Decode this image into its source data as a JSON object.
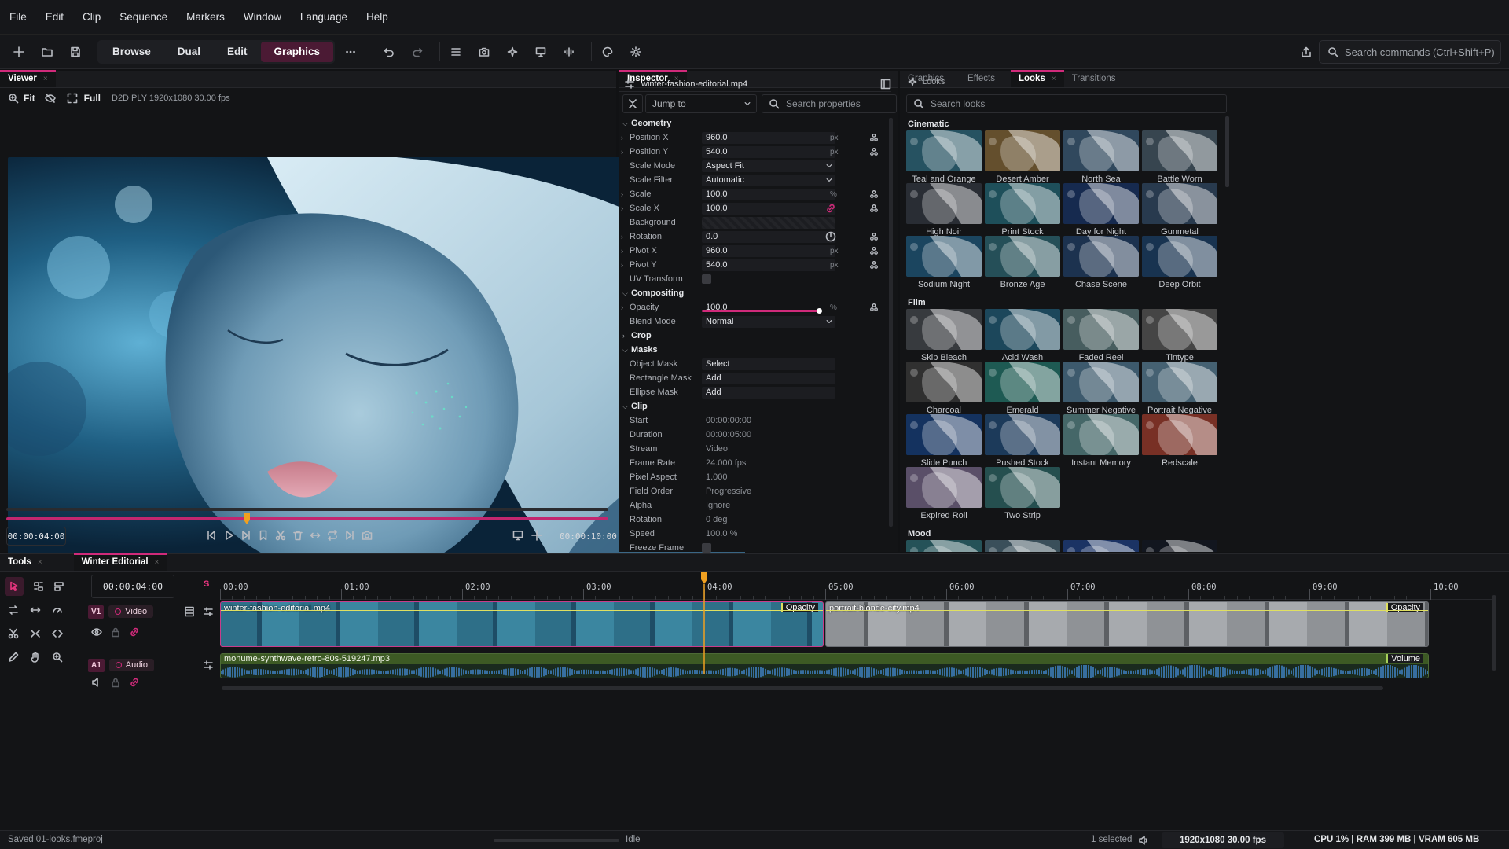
{
  "menu": [
    "File",
    "Edit",
    "Clip",
    "Sequence",
    "Markers",
    "Window",
    "Language",
    "Help"
  ],
  "modes": [
    "Browse",
    "Dual",
    "Edit",
    "Graphics"
  ],
  "active_mode": "Graphics",
  "command_search": {
    "placeholder": "Search commands (Ctrl+Shift+P)"
  },
  "viewer": {
    "tab": "Viewer",
    "fit": "Fit",
    "full": "Full",
    "info": "D2D PLY  1920x1080  30.00 fps",
    "current_time": "00:00:04:00",
    "duration": "00:00:10:00",
    "playhead_fraction": 0.4
  },
  "inspector": {
    "tab": "Inspector",
    "file": "winter-fashion-editorial.mp4",
    "jump_to": "Jump to",
    "search_placeholder": "Search properties",
    "sections": {
      "geometry": "Geometry",
      "compositing": "Compositing",
      "crop": "Crop",
      "masks": "Masks",
      "clip": "Clip"
    },
    "props": {
      "position_x": {
        "label": "Position X",
        "value": "960.0",
        "unit": "px"
      },
      "position_y": {
        "label": "Position Y",
        "value": "540.0",
        "unit": "px"
      },
      "scale_mode": {
        "label": "Scale Mode",
        "value": "Aspect Fit"
      },
      "scale_filter": {
        "label": "Scale Filter",
        "value": "Automatic"
      },
      "scale": {
        "label": "Scale",
        "value": "100.0",
        "unit": "%"
      },
      "scale_x": {
        "label": "Scale X",
        "value": "100.0"
      },
      "background": {
        "label": "Background"
      },
      "rotation": {
        "label": "Rotation",
        "value": "0.0"
      },
      "pivot_x": {
        "label": "Pivot X",
        "value": "960.0",
        "unit": "px"
      },
      "pivot_y": {
        "label": "Pivot Y",
        "value": "540.0",
        "unit": "px"
      },
      "uv_transform": {
        "label": "UV Transform"
      },
      "opacity": {
        "label": "Opacity",
        "value": "100.0",
        "unit": "%",
        "level": 1.0
      },
      "blend_mode": {
        "label": "Blend Mode",
        "value": "Normal"
      },
      "object_mask": {
        "label": "Object Mask",
        "value": "Select"
      },
      "rectangle_mask": {
        "label": "Rectangle Mask",
        "value": "Add"
      },
      "ellipse_mask": {
        "label": "Ellipse Mask",
        "value": "Add"
      }
    },
    "clip_info": [
      {
        "label": "Start",
        "value": "00:00:00:00"
      },
      {
        "label": "Duration",
        "value": "00:00:05:00"
      },
      {
        "label": "Stream",
        "value": "Video"
      },
      {
        "label": "Frame Rate",
        "value": "24.000 fps"
      },
      {
        "label": "Pixel Aspect",
        "value": "1.000"
      },
      {
        "label": "Field Order",
        "value": "Progressive"
      },
      {
        "label": "Alpha",
        "value": "Ignore"
      },
      {
        "label": "Rotation",
        "value": "0 deg"
      },
      {
        "label": "Speed",
        "value": "100.0 %"
      },
      {
        "label": "Freeze Frame",
        "value": ""
      }
    ]
  },
  "library": {
    "tabs": [
      "Graphics",
      "Effects",
      "Looks",
      "Transitions"
    ],
    "active_tab": "Looks",
    "crumb": "Looks",
    "search_placeholder": "Search looks",
    "groups": [
      {
        "name": "Cinematic",
        "looks": [
          {
            "name": "Teal and Orange",
            "tint": "#3b7f95"
          },
          {
            "name": "Desert Amber",
            "tint": "#9a7a45"
          },
          {
            "name": "North Sea",
            "tint": "#4a6f8f"
          },
          {
            "name": "Battle Worn",
            "tint": "#556a7a"
          },
          {
            "name": "High Noir",
            "tint": "#3f4650"
          },
          {
            "name": "Print Stock",
            "tint": "#2f7a8a"
          },
          {
            "name": "Day for Night",
            "tint": "#23417a"
          },
          {
            "name": "Gunmetal",
            "tint": "#3e5a78"
          },
          {
            "name": "Sodium Night",
            "tint": "#2a6a92"
          },
          {
            "name": "Bronze Age",
            "tint": "#3a7a88"
          },
          {
            "name": "Chase Scene",
            "tint": "#2c4e7a"
          },
          {
            "name": "Deep Orbit",
            "tint": "#264f7c"
          }
        ]
      },
      {
        "name": "Film",
        "looks": [
          {
            "name": "Skip Bleach",
            "tint": "#555a60"
          },
          {
            "name": "Acid Wash",
            "tint": "#2b6d8c"
          },
          {
            "name": "Faded Reel",
            "tint": "#6e8f92"
          },
          {
            "name": "Tintype",
            "tint": "#6a6a6a"
          },
          {
            "name": "Charcoal",
            "tint": "#4a4a4a"
          },
          {
            "name": "Emerald",
            "tint": "#2f8a80"
          },
          {
            "name": "Summer Negative",
            "tint": "#5f8aa8"
          },
          {
            "name": "Portrait Negative",
            "tint": "#6a95b0"
          },
          {
            "name": "Slide Punch",
            "tint": "#1f4e92"
          },
          {
            "name": "Pushed Stock",
            "tint": "#2b5a8a"
          },
          {
            "name": "Instant Memory",
            "tint": "#6a9ea0"
          },
          {
            "name": "Redscale",
            "tint": "#b84a3a"
          },
          {
            "name": "Expired Roll",
            "tint": "#8a7aa0"
          },
          {
            "name": "Two Strip",
            "tint": "#3a7a7a"
          }
        ]
      },
      {
        "name": "Mood",
        "looks": [
          {
            "name": "",
            "tint": "#3a7f88"
          },
          {
            "name": "",
            "tint": "#5a7a8a"
          },
          {
            "name": "",
            "tint": "#2a4f9a"
          },
          {
            "name": "",
            "tint": "#1c2230"
          }
        ]
      }
    ]
  },
  "timeline": {
    "tools_tab": "Tools",
    "sequence_tab": "Winter Editorial",
    "timecode": "00:00:04:00",
    "ticks": [
      "00:00",
      "01:00",
      "02:00",
      "03:00",
      "04:00",
      "05:00",
      "06:00",
      "07:00",
      "08:00",
      "09:00",
      "10:00"
    ],
    "playhead_seconds": 4,
    "total_seconds": 10,
    "tracks": {
      "video": {
        "id": "V1",
        "name": "Video"
      },
      "audio": {
        "id": "A1",
        "name": "Audio"
      }
    },
    "clips": [
      {
        "name": "winter-fashion-editorial.mp4",
        "start": 0,
        "end": 5,
        "badge": "Opacity"
      },
      {
        "name": "portrait-blonde-city.mp4",
        "start": 5,
        "end": 10,
        "badge": "Opacity"
      }
    ],
    "audio_clip": {
      "name": "monume-synthwave-retro-80s-519247.mp3",
      "badge": "Volume"
    },
    "solo": "S"
  },
  "status": {
    "saved": "Saved 01-looks.fmeproj",
    "state": "Idle",
    "selected": "1 selected",
    "format": "1920x1080 30.00 fps",
    "resources": "CPU 1%  |  RAM 399 MB  |  VRAM 605 MB"
  },
  "colors": {
    "accent": "#d02a7a",
    "playhead": "#f0a020",
    "track_video": "#c93b8a",
    "track_audio": "#a7d05a"
  }
}
